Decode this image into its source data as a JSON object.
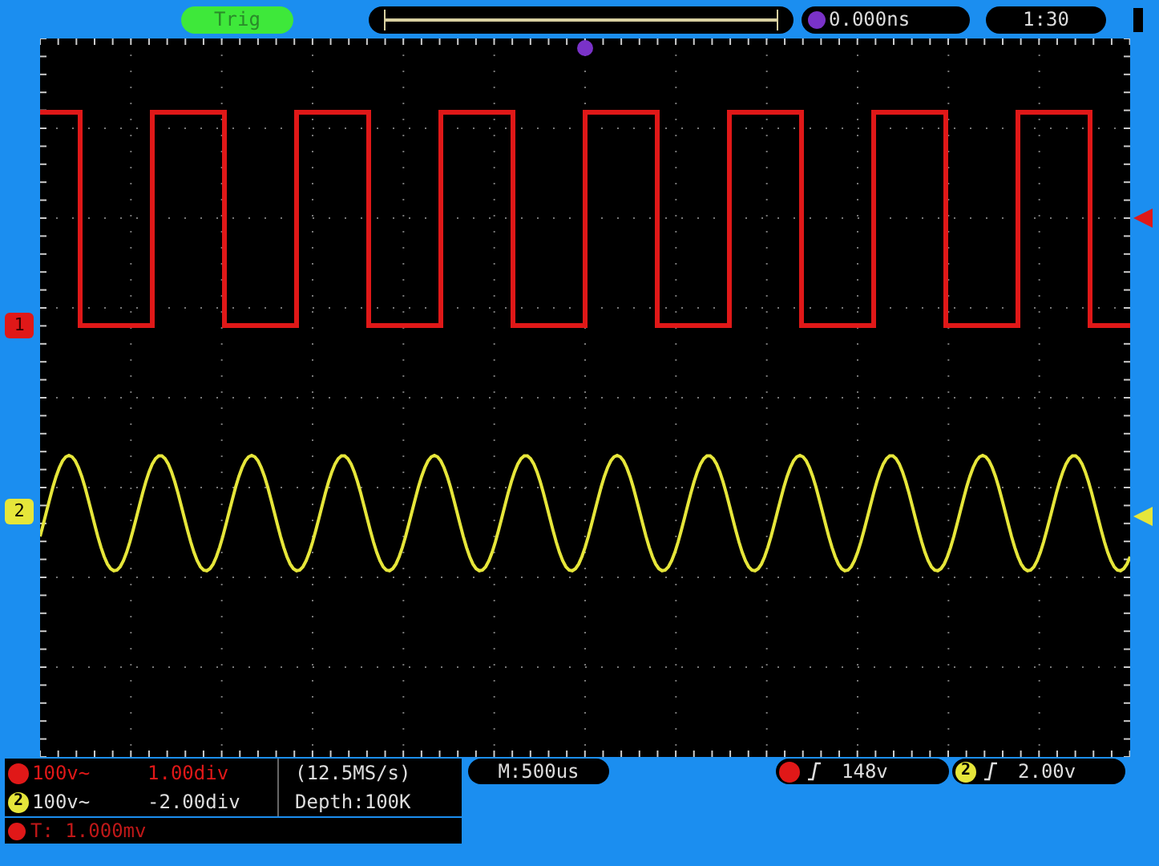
{
  "top_bar": {
    "trigger_status": "Trig",
    "trigger_position": "0.000ns",
    "time": "1:30"
  },
  "channels": [
    {
      "label": "1",
      "color": "#e01818",
      "volts": "100v~",
      "position": "1.00div"
    },
    {
      "label": "2",
      "color": "#e6e63a",
      "badge": "2",
      "volts": "100v~",
      "position": "-2.00div"
    }
  ],
  "sample_rate": "(12.5MS/s)",
  "depth": "Depth:100K",
  "status_line": "T: 1.000mv",
  "timebase": "M:500us",
  "triggers": [
    {
      "color": "#e01818",
      "value": "148v"
    },
    {
      "color": "#e6e63a",
      "badge": "2",
      "value": "2.00v"
    }
  ]
}
